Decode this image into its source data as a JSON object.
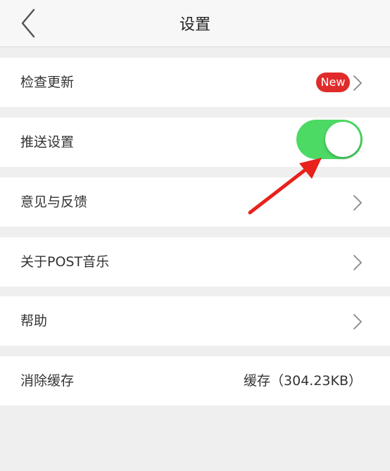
{
  "header": {
    "title": "设置",
    "back_icon": "chevron-left-icon"
  },
  "rows": [
    {
      "label": "检查更新",
      "badge": "New",
      "trailing_icon": "chevron-right-icon"
    },
    {
      "label": "推送设置",
      "toggle": {
        "on": true,
        "color": "#4cd964"
      }
    },
    {
      "label": "意见与反馈",
      "trailing_icon": "chevron-right-icon"
    },
    {
      "label": "关于POST音乐",
      "trailing_icon": "chevron-right-icon"
    },
    {
      "label": "帮助",
      "trailing_icon": "chevron-right-icon"
    },
    {
      "label": "消除缓存",
      "value": "缓存（304.23KB）"
    }
  ],
  "colors": {
    "accent_red": "#e02b2b",
    "toggle_green": "#4cd964",
    "background": "#efefef"
  },
  "annotation": {
    "icon": "red-arrow-icon",
    "color": "#e8211c"
  }
}
